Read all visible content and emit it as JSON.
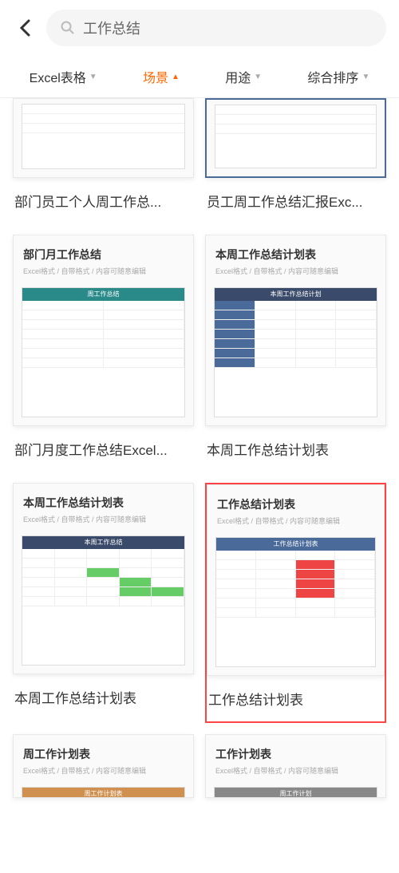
{
  "search": {
    "query": "工作总结"
  },
  "filters": {
    "items": [
      {
        "label": "Excel表格",
        "active": false
      },
      {
        "label": "场景",
        "active": true
      },
      {
        "label": "用途",
        "active": false
      },
      {
        "label": "综合排序",
        "active": false
      }
    ]
  },
  "thumb_subtitle": "Excel格式 / 自带格式 / 内容可随意编辑",
  "cards": [
    {
      "label": "部门员工个人周工作总...",
      "thumb_title": "",
      "style": "partial-top",
      "scheme": "plain"
    },
    {
      "label": "员工周工作总结汇报Exc...",
      "thumb_title": "",
      "style": "partial-top",
      "scheme": "blue-border"
    },
    {
      "label": "部门月度工作总结Excel...",
      "thumb_title": "部门月工作总结",
      "style": "full",
      "scheme": "teal",
      "banner": "周工作总结"
    },
    {
      "label": "本周工作总结计划表",
      "thumb_title": "本周工作总结计划表",
      "style": "full",
      "scheme": "blue",
      "banner": "本周工作总结计划"
    },
    {
      "label": "本周工作总结计划表",
      "thumb_title": "本周工作总结计划表",
      "style": "full",
      "scheme": "green",
      "banner": "本周工作总结"
    },
    {
      "label": "工作总结计划表",
      "thumb_title": "工作总结计划表",
      "style": "full",
      "scheme": "red",
      "banner": "工作总结计划表",
      "highlighted": true
    },
    {
      "label": "",
      "thumb_title": "周工作计划表",
      "style": "partial-bottom",
      "scheme": "circles",
      "banner": "周工作计划表"
    },
    {
      "label": "",
      "thumb_title": "工作计划表",
      "style": "partial-bottom",
      "scheme": "gray",
      "banner": "周工作计划"
    }
  ]
}
